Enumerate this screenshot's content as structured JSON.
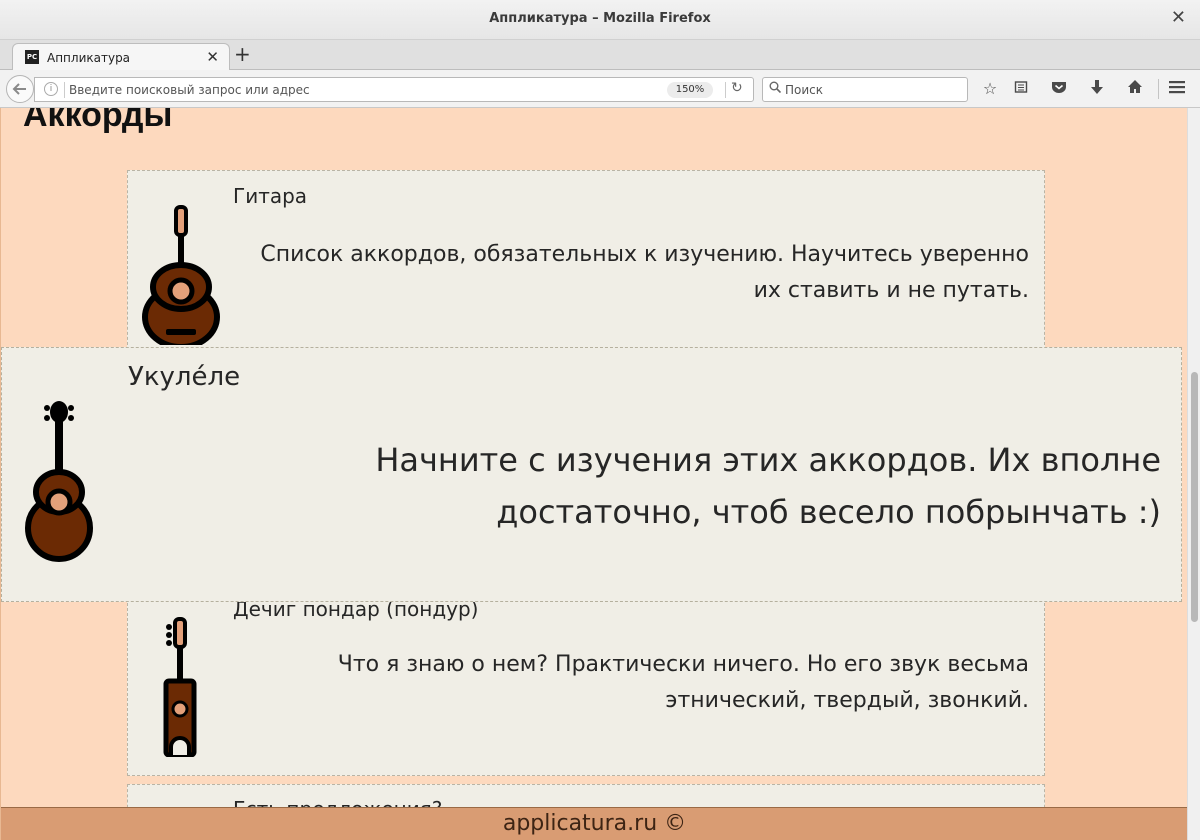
{
  "window": {
    "title": "Аппликатура – Mozilla Firefox",
    "close_glyph": "✕"
  },
  "tab": {
    "title": "Аппликатура",
    "favicon_text": "PC",
    "close_glyph": "✕",
    "new_tab_glyph": "+"
  },
  "navbar": {
    "url_placeholder": "Введите поисковый запрос или адрес",
    "zoom": "150%",
    "search_placeholder": "Поиск"
  },
  "page": {
    "heading": "Аккорды",
    "cards": [
      {
        "name": "Гитара",
        "description": "Список аккордов, обязательных к изучению. Научитесь уверенно их ставить и не путать.",
        "icon": "guitar-icon"
      },
      {
        "name": "Укуле́ле",
        "description": "Начните с изучения этих аккордов. Их вполне достаточно, чтоб весело побрынчать :)",
        "icon": "ukulele-icon"
      },
      {
        "name": "Дечиг пондар (пондур)",
        "description": "Что я знаю о нем? Практически ничего. Но его звук весьма этнический, твердый, звонкий.",
        "icon": "pondur-icon"
      },
      {
        "name": "Есть предложения?"
      }
    ],
    "footer": "applicatura.ru ©"
  },
  "colors": {
    "page_background": "#fdd9be",
    "card_background": "#f0eee6",
    "footer_background": "#d99c73",
    "instrument_body": "#6b2a04",
    "instrument_accent": "#e3a07a"
  }
}
